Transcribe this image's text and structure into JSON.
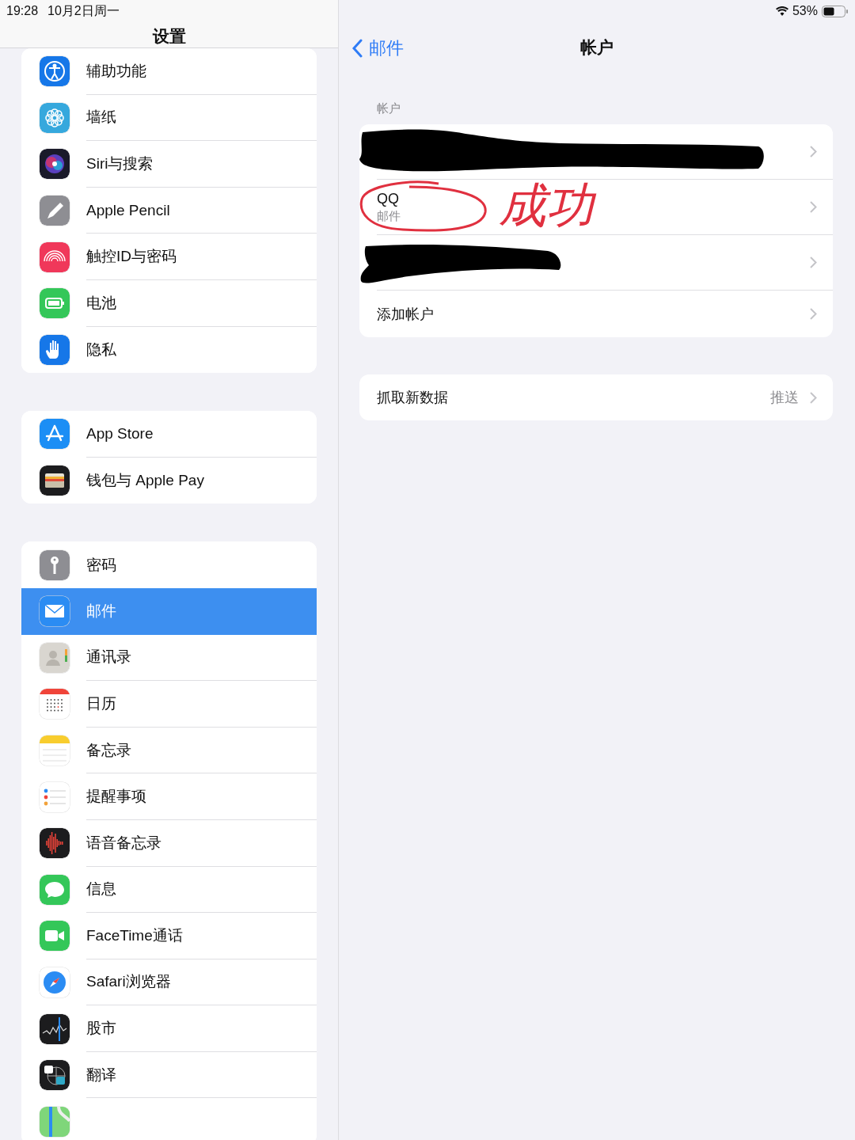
{
  "status_bar": {
    "time": "19:28",
    "date": "10月2日周一",
    "battery": "53%"
  },
  "sidebar": {
    "title": "设置",
    "groups": [
      {
        "items": [
          {
            "kind": "row",
            "label": "辅助功能",
            "selected": false
          },
          {
            "kind": "row",
            "label": "墙纸",
            "selected": false
          },
          {
            "kind": "row",
            "label": "Siri与搜索",
            "selected": false
          },
          {
            "kind": "row",
            "label": "Apple Pencil",
            "selected": false
          },
          {
            "kind": "row",
            "label": "触控ID与密码",
            "selected": false
          },
          {
            "kind": "row",
            "label": "电池",
            "selected": false
          },
          {
            "kind": "row",
            "label": "隐私",
            "selected": false
          }
        ]
      },
      {
        "items": [
          {
            "kind": "row",
            "label": "App Store",
            "selected": false
          },
          {
            "kind": "row",
            "label": "钱包与 Apple Pay",
            "selected": false
          }
        ]
      },
      {
        "items": [
          {
            "kind": "row",
            "label": "密码",
            "selected": false
          },
          {
            "kind": "row",
            "label": "邮件",
            "selected": true
          },
          {
            "kind": "row",
            "label": "通讯录",
            "selected": false
          },
          {
            "kind": "row",
            "label": "日历",
            "selected": false
          },
          {
            "kind": "row",
            "label": "备忘录",
            "selected": false
          },
          {
            "kind": "row",
            "label": "提醒事项",
            "selected": false
          },
          {
            "kind": "row",
            "label": "语音备忘录",
            "selected": false
          },
          {
            "kind": "row",
            "label": "信息",
            "selected": false
          },
          {
            "kind": "row",
            "label": "FaceTime通话",
            "selected": false
          },
          {
            "kind": "row",
            "label": "Safari浏览器",
            "selected": false
          },
          {
            "kind": "row",
            "label": "股市",
            "selected": false
          },
          {
            "kind": "row",
            "label": "翻译",
            "selected": false
          },
          {
            "kind": "partial",
            "selected": false
          }
        ]
      }
    ]
  },
  "detail": {
    "back": "邮件",
    "title": "帐户",
    "section_header": "帐户",
    "accounts": [
      {
        "kind": "redacted"
      },
      {
        "kind": "account",
        "title": "QQ",
        "subtitle": "邮件"
      },
      {
        "kind": "redacted"
      },
      {
        "kind": "action",
        "title": "添加帐户"
      }
    ],
    "fetch": {
      "label": "抓取新数据",
      "value": "推送"
    },
    "annotation": {
      "text": "成功",
      "color": "#e0303f"
    }
  }
}
